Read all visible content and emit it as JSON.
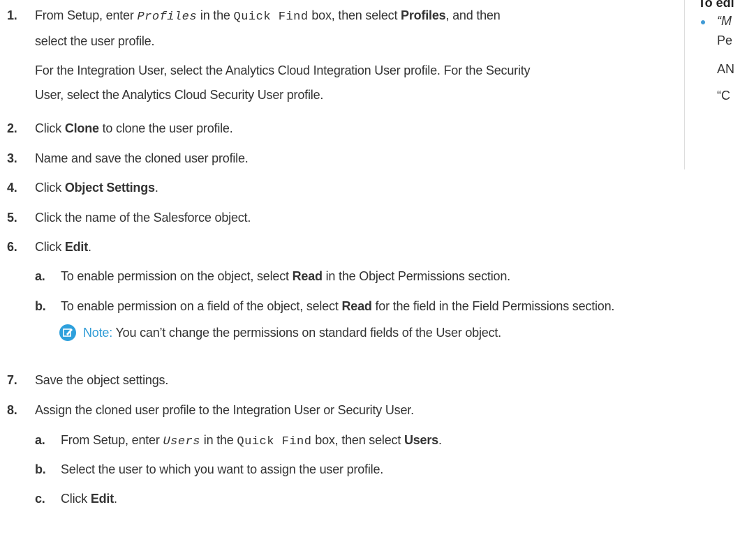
{
  "steps": {
    "s1": {
      "num": "1.",
      "a": "From Setup, enter ",
      "code1": "Profiles",
      "b": " in the ",
      "code2": "Quick Find",
      "c": " box, then select ",
      "bold": "Profiles",
      "d": ", and then",
      "line2": "select the user profile.",
      "para1": "For the Integration User, select the Analytics Cloud Integration User profile. For the Security",
      "para2": "User, select the Analytics Cloud Security User profile."
    },
    "s2": {
      "num": "2.",
      "a": "Click ",
      "bold": "Clone",
      "b": " to clone the user profile."
    },
    "s3": {
      "num": "3.",
      "text": "Name and save the cloned user profile."
    },
    "s4": {
      "num": "4.",
      "a": "Click ",
      "bold": "Object Settings",
      "b": "."
    },
    "s5": {
      "num": "5.",
      "text": "Click the name of the Salesforce object."
    },
    "s6": {
      "num": "6.",
      "a": "Click ",
      "bold": "Edit",
      "b": ".",
      "sa": {
        "num": "a.",
        "a": "To enable permission on the object, select ",
        "bold": "Read",
        "b": " in the Object Permissions section."
      },
      "sb": {
        "num": "b.",
        "a": "To enable permission on a field of the object, select ",
        "bold": "Read",
        "b": " for the field in the Field Permissions section."
      },
      "note": {
        "label": "Note:",
        "text": "  You can’t change the permissions on standard fields of the User object."
      }
    },
    "s7": {
      "num": "7.",
      "text": "Save the object settings."
    },
    "s8": {
      "num": "8.",
      "text": "Assign the cloned user profile to the Integration User or Security User.",
      "sa": {
        "num": "a.",
        "a": "From Setup, enter ",
        "code1": "Users",
        "b": " in the ",
        "code2": "Quick Find",
        "c": " box, then select ",
        "bold": "Users",
        "d": "."
      },
      "sb": {
        "num": "b.",
        "text": "Select the user to which you want to assign the user profile."
      },
      "sc": {
        "num": "c.",
        "a": "Click ",
        "bold": "Edit",
        "b": "."
      }
    }
  },
  "sidebar": {
    "heading": "To edi",
    "line1": "“M",
    "line2": "Pe",
    "line3": "AN",
    "line4": "“C"
  },
  "colors": {
    "bullet": "#3f9ad5",
    "note": "#2e9bd6"
  },
  "icons": {
    "note": "note-edit-icon"
  }
}
